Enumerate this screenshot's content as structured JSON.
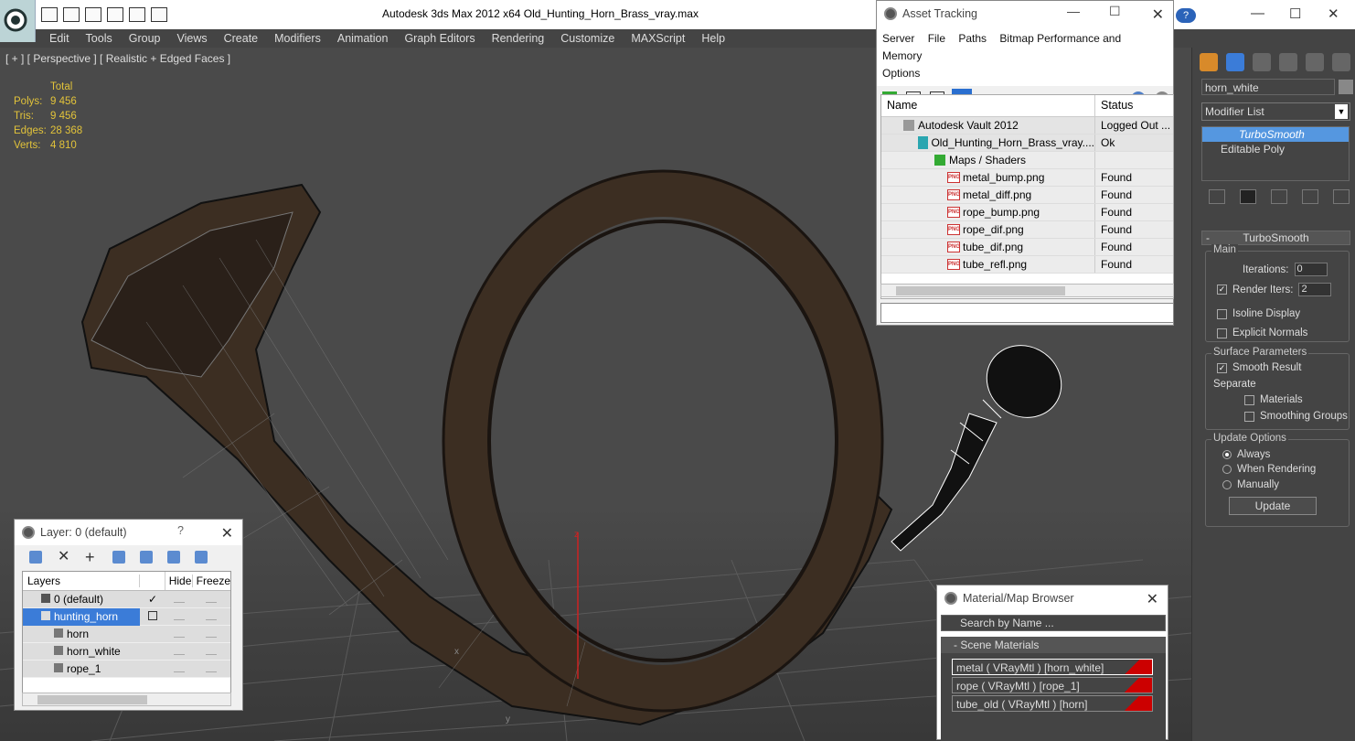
{
  "window": {
    "title": "Autodesk 3ds Max  2012 x64       Old_Hunting_Horn_Brass_vray.max",
    "help": "?"
  },
  "menu": [
    "Edit",
    "Tools",
    "Group",
    "Views",
    "Create",
    "Modifiers",
    "Animation",
    "Graph Editors",
    "Rendering",
    "Customize",
    "MAXScript",
    "Help"
  ],
  "viewport": {
    "label": "[ + ] [ Perspective ] [ Realistic + Edged Faces ]",
    "stats_header": "Total",
    "stats": [
      {
        "k": "Polys:",
        "v": "9 456"
      },
      {
        "k": "Tris:",
        "v": "9 456"
      },
      {
        "k": "Edges:",
        "v": "28 368"
      },
      {
        "k": "Verts:",
        "v": "4 810"
      }
    ],
    "axis_z": "z",
    "axis_x": "x",
    "axis_y": "y"
  },
  "asset_tracking": {
    "title": "Asset Tracking",
    "menu": [
      "Server",
      "File",
      "Paths",
      "Bitmap Performance and Memory"
    ],
    "menu2": "Options",
    "col_name": "Name",
    "col_status": "Status",
    "rows": [
      {
        "name": "Autodesk Vault 2012",
        "status": "Logged Out ..."
      },
      {
        "name": "Old_Hunting_Horn_Brass_vray....",
        "status": "Ok"
      },
      {
        "name": "Maps / Shaders",
        "status": ""
      },
      {
        "name": "metal_bump.png",
        "status": "Found"
      },
      {
        "name": "metal_diff.png",
        "status": "Found"
      },
      {
        "name": "rope_bump.png",
        "status": "Found"
      },
      {
        "name": "rope_dif.png",
        "status": "Found"
      },
      {
        "name": "tube_dif.png",
        "status": "Found"
      },
      {
        "name": "tube_refl.png",
        "status": "Found"
      }
    ],
    "png_label": "PNG"
  },
  "command_panel": {
    "object_name": "horn_white",
    "modifier_list": "Modifier List",
    "stack": [
      "TurboSmooth",
      "Editable Poly"
    ],
    "rollout": "TurboSmooth",
    "rollout_toggle": "-",
    "main_label": "Main",
    "iterations_label": "Iterations:",
    "iterations": "0",
    "render_iters_label": "Render Iters:",
    "render_iters": "2",
    "isoline": "Isoline Display",
    "explicit_normals": "Explicit Normals",
    "surface_label": "Surface Parameters",
    "smooth_result": "Smooth Result",
    "separate": "Separate",
    "materials": "Materials",
    "smoothing_groups": "Smoothing Groups",
    "update_options": "Update Options",
    "always": "Always",
    "when_rendering": "When Rendering",
    "manually": "Manually",
    "update": "Update",
    "check": "✓"
  },
  "layer_panel": {
    "title": "Layer: 0 (default)",
    "help": "?",
    "col_layers": "Layers",
    "col_hide": "Hide",
    "col_freeze": "Freeze",
    "rows": [
      {
        "name": "0 (default)"
      },
      {
        "name": "hunting_horn"
      },
      {
        "name": "horn"
      },
      {
        "name": "horn_white"
      },
      {
        "name": "rope_1"
      }
    ]
  },
  "material_browser": {
    "title": "Material/Map Browser",
    "search": "Search by Name ...",
    "section": "- Scene Materials",
    "materials": [
      "metal  ( VRayMtl ) [horn_white]",
      "rope  ( VRayMtl ) [rope_1]",
      "tube_old  ( VRayMtl ) [horn]"
    ]
  },
  "colors": {
    "accent": "#3b7cd8",
    "stats": "#e2c33a",
    "viewport_bg": "#4a4a4a"
  }
}
